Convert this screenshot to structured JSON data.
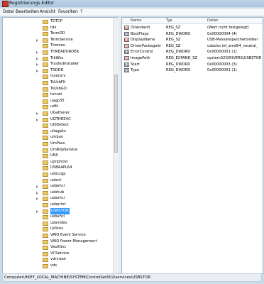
{
  "window": {
    "title": "Registrierungs-Editor"
  },
  "menu": [
    "Datei",
    "Bearbeiten",
    "Ansicht",
    "Favoriten",
    "?"
  ],
  "tree": [
    {
      "label": "TDTCP",
      "expandable": false
    },
    {
      "label": "tdx",
      "expandable": false
    },
    {
      "label": "TermDD",
      "expandable": false
    },
    {
      "label": "TermService",
      "expandable": true
    },
    {
      "label": "Themes",
      "expandable": false
    },
    {
      "label": "THREADORDER",
      "expandable": true
    },
    {
      "label": "TrkWks",
      "expandable": true
    },
    {
      "label": "TrustedInstaller",
      "expandable": true
    },
    {
      "label": "TSDDD",
      "expandable": true
    },
    {
      "label": "tssecsrv",
      "expandable": false
    },
    {
      "label": "TsUsbFlt",
      "expandable": false
    },
    {
      "label": "TsUsbGD",
      "expandable": false
    },
    {
      "label": "tunnel",
      "expandable": false
    },
    {
      "label": "uagp35",
      "expandable": false
    },
    {
      "label": "udfs",
      "expandable": false
    },
    {
      "label": "UGatherer",
      "expandable": true
    },
    {
      "label": "UGTHRSVC",
      "expandable": true
    },
    {
      "label": "UI0Detect",
      "expandable": false
    },
    {
      "label": "uliagpkx",
      "expandable": false
    },
    {
      "label": "umbus",
      "expandable": false
    },
    {
      "label": "UmPass",
      "expandable": false
    },
    {
      "label": "UmRdpService",
      "expandable": false
    },
    {
      "label": "UNS",
      "expandable": false
    },
    {
      "label": "upnphost",
      "expandable": false
    },
    {
      "label": "USBAAPL64",
      "expandable": false
    },
    {
      "label": "usbccgp",
      "expandable": false
    },
    {
      "label": "usbcir",
      "expandable": false
    },
    {
      "label": "usbehci",
      "expandable": true
    },
    {
      "label": "usbhub",
      "expandable": true
    },
    {
      "label": "usbohci",
      "expandable": true
    },
    {
      "label": "usbprint",
      "expandable": false
    },
    {
      "label": "USBSTOR",
      "expandable": true,
      "selected": true
    },
    {
      "label": "usbuhci",
      "expandable": false
    },
    {
      "label": "usbvideo",
      "expandable": false
    },
    {
      "label": "UxSms",
      "expandable": false
    },
    {
      "label": "VAIO Event Service",
      "expandable": false
    },
    {
      "label": "VAIO Power Management",
      "expandable": false
    },
    {
      "label": "VaultSvc",
      "expandable": false
    },
    {
      "label": "VCService",
      "expandable": false
    },
    {
      "label": "vdrvroot",
      "expandable": false
    },
    {
      "label": "vds",
      "expandable": false
    }
  ],
  "columns": {
    "name": "Name",
    "type": "Typ",
    "data": "Daten"
  },
  "values": [
    {
      "name": "(Standard)",
      "type": "REG_SZ",
      "data": "(Wert nicht festgelegt)",
      "icon": "string-value-icon",
      "glyph": "ab"
    },
    {
      "name": "BootFlags",
      "type": "REG_DWORD",
      "data": "0x00000004 (4)",
      "icon": "binary-value-icon",
      "glyph": "01"
    },
    {
      "name": "DisplayName",
      "type": "REG_SZ",
      "data": "USB-Massenspeichertreiber",
      "icon": "string-value-icon",
      "glyph": "ab"
    },
    {
      "name": "DriverPackageId",
      "type": "REG_SZ",
      "data": "usbstor.inf_amd64_neutral_",
      "icon": "string-value-icon",
      "glyph": "ab"
    },
    {
      "name": "ErrorControl",
      "type": "REG_DWORD",
      "data": "0x00000001 (1)",
      "icon": "binary-value-icon",
      "glyph": "01"
    },
    {
      "name": "ImagePath",
      "type": "REG_EXPAND_SZ",
      "data": "system32\\DRIVERS\\USBSTOR",
      "icon": "string-value-icon",
      "glyph": "ab"
    },
    {
      "name": "Start",
      "type": "REG_DWORD",
      "data": "0x00000003 (3)",
      "icon": "binary-value-icon",
      "glyph": "01"
    },
    {
      "name": "Type",
      "type": "REG_DWORD",
      "data": "0x00000001 (1)",
      "icon": "binary-value-icon",
      "glyph": "01"
    }
  ],
  "status": "Computer\\HKEY_LOCAL_MACHINE\\SYSTEM\\ControlSet002\\services\\USBSTOR"
}
